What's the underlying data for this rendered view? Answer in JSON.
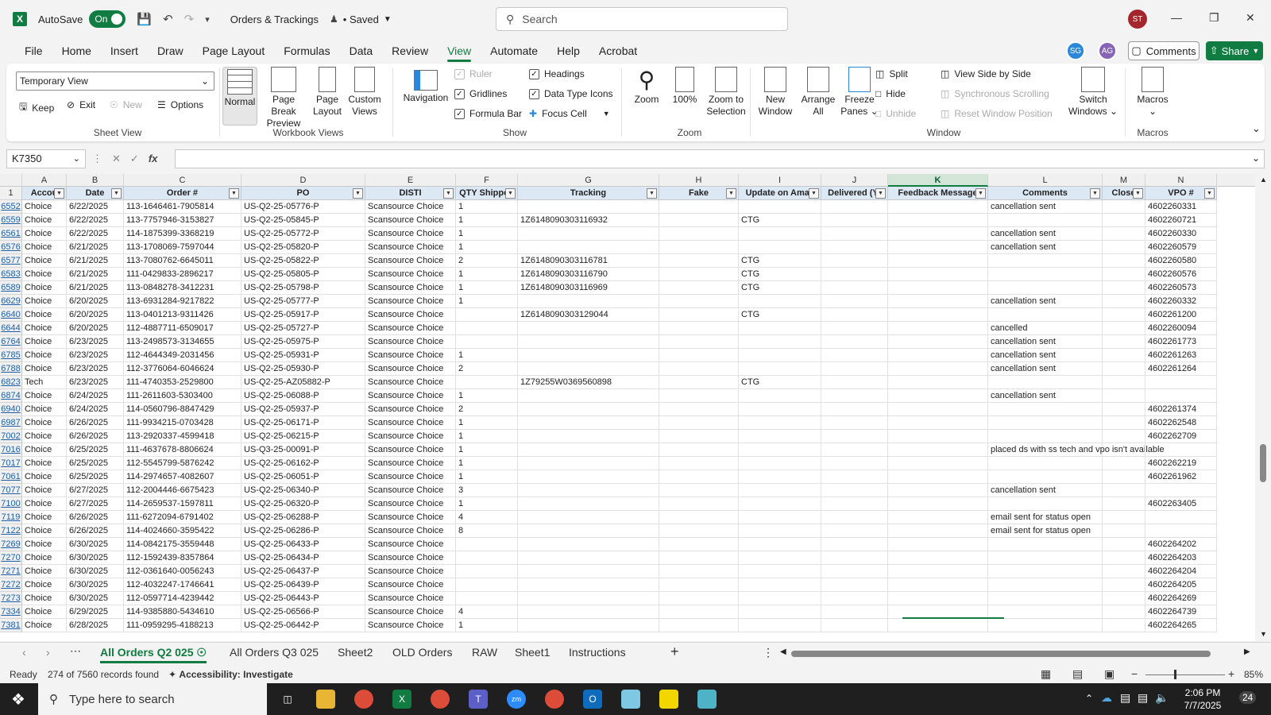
{
  "titlebar": {
    "app_letter": "X",
    "autosave_label": "AutoSave",
    "autosave_state": "On",
    "doc_title": "Orders & Trackings",
    "saved_status": "• Saved",
    "search_placeholder": "Search",
    "user_initials": "ST"
  },
  "menu": {
    "tabs": [
      "File",
      "Home",
      "Insert",
      "Draw",
      "Page Layout",
      "Formulas",
      "Data",
      "Review",
      "View",
      "Automate",
      "Help",
      "Acrobat"
    ],
    "active": "View",
    "collab1": "SG",
    "collab2": "AG",
    "comments_label": "Comments",
    "share_label": "Share"
  },
  "ribbon": {
    "sheet_view": {
      "dropdown_value": "Temporary View",
      "keep": "Keep",
      "exit": "Exit",
      "new": "New",
      "options": "Options",
      "label": "Sheet View"
    },
    "workbook_views": {
      "normal": "Normal",
      "page_break_1": "Page Break",
      "page_break_2": "Preview",
      "page_layout_1": "Page",
      "page_layout_2": "Layout",
      "custom_1": "Custom",
      "custom_2": "Views",
      "label": "Workbook Views"
    },
    "show": {
      "navigation": "Navigation",
      "ruler": "Ruler",
      "gridlines": "Gridlines",
      "formula_bar": "Formula Bar",
      "headings": "Headings",
      "data_type_icons": "Data Type Icons",
      "focus_cell": "Focus Cell",
      "label": "Show"
    },
    "zoom": {
      "zoom": "Zoom",
      "hundred": "100%",
      "zoom_sel_1": "Zoom to",
      "zoom_sel_2": "Selection",
      "label": "Zoom"
    },
    "window": {
      "new_1": "New",
      "new_2": "Window",
      "arrange_1": "Arrange",
      "arrange_2": "All",
      "freeze_1": "Freeze",
      "freeze_2": "Panes",
      "split": "Split",
      "hide": "Hide",
      "unhide": "Unhide",
      "side_by_side": "View Side by Side",
      "sync_scroll": "Synchronous Scrolling",
      "reset_pos": "Reset Window Position",
      "switch_1": "Switch",
      "switch_2": "Windows",
      "label": "Window"
    },
    "macros": {
      "macros": "Macros",
      "label": "Macros"
    }
  },
  "formula_bar": {
    "name_box": "K7350",
    "fx": "fx",
    "value": ""
  },
  "grid": {
    "col_letters": [
      "A",
      "B",
      "C",
      "D",
      "E",
      "F",
      "G",
      "H",
      "I",
      "J",
      "K",
      "L",
      "M",
      "N"
    ],
    "header_row_num": "1",
    "headers": [
      "Accou",
      "Date",
      "Order #",
      "PO",
      "DISTI",
      "QTY Shipped",
      "Tracking",
      "Fake",
      "Update on Amaz",
      "Delivered (Y/",
      "Feedback Message",
      "Comments",
      "Close",
      "VPO #"
    ],
    "rows": [
      [
        "6552",
        "Choice",
        "6/22/2025",
        "113-1646461-7905814",
        "US-Q2-25-05776-P",
        "Scansource Choice",
        "1",
        "",
        "",
        "",
        "",
        "",
        "cancellation sent",
        "",
        "4602260331"
      ],
      [
        "6559",
        "Choice",
        "6/22/2025",
        "113-7757946-3153827",
        "US-Q2-25-05845-P",
        "Scansource Choice",
        "1",
        "1Z6148090303116932",
        "",
        "CTG",
        "",
        "",
        "",
        "",
        "4602260721"
      ],
      [
        "6561",
        "Choice",
        "6/22/2025",
        "114-1875399-3368219",
        "US-Q2-25-05772-P",
        "Scansource Choice",
        "1",
        "",
        "",
        "",
        "",
        "",
        "cancellation sent",
        "",
        "4602260330"
      ],
      [
        "6576",
        "Choice",
        "6/21/2025",
        "113-1708069-7597044",
        "US-Q2-25-05820-P",
        "Scansource Choice",
        "1",
        "",
        "",
        "",
        "",
        "",
        "cancellation sent",
        "",
        "4602260579"
      ],
      [
        "6577",
        "Choice",
        "6/21/2025",
        "113-7080762-6645011",
        "US-Q2-25-05822-P",
        "Scansource Choice",
        "2",
        "1Z6148090303116781",
        "",
        "CTG",
        "",
        "",
        "",
        "",
        "4602260580"
      ],
      [
        "6583",
        "Choice",
        "6/21/2025",
        "111-0429833-2896217",
        "US-Q2-25-05805-P",
        "Scansource Choice",
        "1",
        "1Z6148090303116790",
        "",
        "CTG",
        "",
        "",
        "",
        "",
        "4602260576"
      ],
      [
        "6589",
        "Choice",
        "6/21/2025",
        "113-0848278-3412231",
        "US-Q2-25-05798-P",
        "Scansource Choice",
        "1",
        "1Z6148090303116969",
        "",
        "CTG",
        "",
        "",
        "",
        "",
        "4602260573"
      ],
      [
        "6629",
        "Choice",
        "6/20/2025",
        "113-6931284-9217822",
        "US-Q2-25-05777-P",
        "Scansource Choice",
        "1",
        "",
        "",
        "",
        "",
        "",
        "cancellation sent",
        "",
        "4602260332"
      ],
      [
        "6640",
        "Choice",
        "6/20/2025",
        "113-0401213-9311426",
        "US-Q2-25-05917-P",
        "Scansource Choice",
        "",
        "1Z6148090303129044",
        "",
        "CTG",
        "",
        "",
        "",
        "",
        "4602261200"
      ],
      [
        "6644",
        "Choice",
        "6/20/2025",
        "112-4887711-6509017",
        "US-Q2-25-05727-P",
        "Scansource Choice",
        "",
        "",
        "",
        "",
        "",
        "",
        "cancelled",
        "",
        "4602260094"
      ],
      [
        "6764",
        "Choice",
        "6/23/2025",
        "113-2498573-3134655",
        "US-Q2-25-05975-P",
        "Scansource Choice",
        "",
        "",
        "",
        "",
        "",
        "",
        "cancellation sent",
        "",
        "4602261773"
      ],
      [
        "6785",
        "Choice",
        "6/23/2025",
        "112-4644349-2031456",
        "US-Q2-25-05931-P",
        "Scansource Choice",
        "1",
        "",
        "",
        "",
        "",
        "",
        "cancellation sent",
        "",
        "4602261263"
      ],
      [
        "6788",
        "Choice",
        "6/23/2025",
        "112-3776064-6046624",
        "US-Q2-25-05930-P",
        "Scansource Choice",
        "2",
        "",
        "",
        "",
        "",
        "",
        "cancellation sent",
        "",
        "4602261264"
      ],
      [
        "6823",
        "Tech",
        "6/23/2025",
        "111-4740353-2529800",
        "US-Q2-25-AZ05882-P",
        "Scansource Choice",
        "",
        "1Z79255W0369560898",
        "",
        "CTG",
        "",
        "",
        "",
        "",
        ""
      ],
      [
        "6874",
        "Choice",
        "6/24/2025",
        "111-2611603-5303400",
        "US-Q2-25-06088-P",
        "Scansource Choice",
        "1",
        "",
        "",
        "",
        "",
        "",
        "cancellation sent",
        "",
        ""
      ],
      [
        "6940",
        "Choice",
        "6/24/2025",
        "114-0560796-8847429",
        "US-Q2-25-05937-P",
        "Scansource Choice",
        "2",
        "",
        "",
        "",
        "",
        "",
        "",
        "",
        "4602261374"
      ],
      [
        "6987",
        "Choice",
        "6/26/2025",
        "111-9934215-0703428",
        "US-Q2-25-06171-P",
        "Scansource Choice",
        "1",
        "",
        "",
        "",
        "",
        "",
        "",
        "",
        "4602262548"
      ],
      [
        "7002",
        "Choice",
        "6/26/2025",
        "113-2920337-4599418",
        "US-Q2-25-06215-P",
        "Scansource Choice",
        "1",
        "",
        "",
        "",
        "",
        "",
        "",
        "",
        "4602262709"
      ],
      [
        "7016",
        "Choice",
        "6/25/2025",
        "111-4637678-8806624",
        "US-Q3-25-00091-P",
        "Scansource Choice",
        "1",
        "",
        "",
        "",
        "",
        "",
        "placed ds with ss tech and vpo isn't available",
        "",
        ""
      ],
      [
        "7017",
        "Choice",
        "6/25/2025",
        "112-5545799-5876242",
        "US-Q2-25-06162-P",
        "Scansource Choice",
        "1",
        "",
        "",
        "",
        "",
        "",
        "",
        "",
        "4602262219"
      ],
      [
        "7061",
        "Choice",
        "6/25/2025",
        "114-2974657-4082607",
        "US-Q2-25-06051-P",
        "Scansource Choice",
        "1",
        "",
        "",
        "",
        "",
        "",
        "",
        "",
        "4602261962"
      ],
      [
        "7077",
        "Choice",
        "6/27/2025",
        "112-2004446-6675423",
        "US-Q2-25-06340-P",
        "Scansource Choice",
        "3",
        "",
        "",
        "",
        "",
        "",
        "cancellation sent",
        "",
        ""
      ],
      [
        "7100",
        "Choice",
        "6/27/2025",
        "114-2659537-1597811",
        "US-Q2-25-06320-P",
        "Scansource Choice",
        "1",
        "",
        "",
        "",
        "",
        "",
        "",
        "",
        "4602263405"
      ],
      [
        "7119",
        "Choice",
        "6/26/2025",
        "111-6272094-6791402",
        "US-Q2-25-06288-P",
        "Scansource Choice",
        "4",
        "",
        "",
        "",
        "",
        "",
        "email sent for status open",
        "",
        ""
      ],
      [
        "7122",
        "Choice",
        "6/26/2025",
        "114-4024660-3595422",
        "US-Q2-25-06286-P",
        "Scansource Choice",
        "8",
        "",
        "",
        "",
        "",
        "",
        "email sent for status open",
        "",
        ""
      ],
      [
        "7269",
        "Choice",
        "6/30/2025",
        "114-0842175-3559448",
        "US-Q2-25-06433-P",
        "Scansource Choice",
        "",
        "",
        "",
        "",
        "",
        "",
        "",
        "",
        "4602264202"
      ],
      [
        "7270",
        "Choice",
        "6/30/2025",
        "112-1592439-8357864",
        "US-Q2-25-06434-P",
        "Scansource Choice",
        "",
        "",
        "",
        "",
        "",
        "",
        "",
        "",
        "4602264203"
      ],
      [
        "7271",
        "Choice",
        "6/30/2025",
        "112-0361640-0056243",
        "US-Q2-25-06437-P",
        "Scansource Choice",
        "",
        "",
        "",
        "",
        "",
        "",
        "",
        "",
        "4602264204"
      ],
      [
        "7272",
        "Choice",
        "6/30/2025",
        "112-4032247-1746641",
        "US-Q2-25-06439-P",
        "Scansource Choice",
        "",
        "",
        "",
        "",
        "",
        "",
        "",
        "",
        "4602264205"
      ],
      [
        "7273",
        "Choice",
        "6/30/2025",
        "112-0597714-4239442",
        "US-Q2-25-06443-P",
        "Scansource Choice",
        "",
        "",
        "",
        "",
        "",
        "",
        "",
        "",
        "4602264269"
      ],
      [
        "7334",
        "Choice",
        "6/29/2025",
        "114-9385880-5434610",
        "US-Q2-25-06566-P",
        "Scansource Choice",
        "4",
        "",
        "",
        "",
        "",
        "",
        "",
        "",
        "4602264739"
      ],
      [
        "7381",
        "Choice",
        "6/28/2025",
        "111-0959295-4188213",
        "US-Q2-25-06442-P",
        "Scansource Choice",
        "1",
        "",
        "",
        "",
        "",
        "",
        "",
        "",
        "4602264265"
      ]
    ]
  },
  "sheets": {
    "tabs": [
      "All Orders Q2 025",
      "All Orders Q3 025",
      "Sheet2",
      "OLD Orders",
      "RAW",
      "Sheet1",
      "Instructions"
    ],
    "active": "All Orders Q2 025",
    "add": "+"
  },
  "status": {
    "ready": "Ready",
    "records": "274 of 7560 records found",
    "accessibility": "Accessibility: Investigate",
    "zoom": "85%"
  },
  "taskbar": {
    "search_placeholder": "Type here to search",
    "time": "2:06 PM",
    "date": "7/7/2025",
    "notif_count": "24"
  },
  "colors": {
    "excel_green": "#107c41",
    "header_fill": "#dde8f5",
    "row_link": "#1f5fa8"
  }
}
